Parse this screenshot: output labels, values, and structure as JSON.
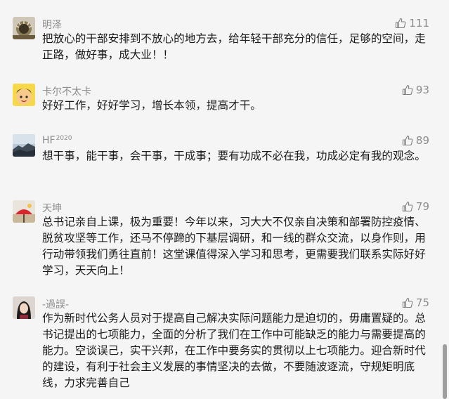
{
  "comments": [
    {
      "user": "明泽",
      "user_sup": "",
      "likes": "111",
      "text": "把放心的干部安排到不放心的地方去，给年轻干部充分的信任，足够的空间，走正路，做好事，成大业！！"
    },
    {
      "user": "卡尔不太卡",
      "user_sup": "",
      "likes": "93",
      "text": "好好工作，好好学习，增长本领，提高才干。"
    },
    {
      "user": "HF",
      "user_sup": "2020",
      "likes": "89",
      "text": "想干事，能干事，会干事，干成事；要有功成不必在我，功成必定有我的观念。"
    },
    {
      "user": "天坤",
      "user_sup": "",
      "likes": "79",
      "text": "总书记亲自上课，极为重要！今年以来，习大大不仅亲自决策和部署防控疫情、脱贫攻坚等工作，还马不停蹄的下基层调研，和一线的群众交流，以身作则，用行动带领我们勇往直前！这堂课值得深入学习和思考，更需要我们联系实际好好学习，天天向上！"
    },
    {
      "user": "-過誤-",
      "user_sup": "",
      "likes": "75",
      "text": "作为新时代公务人员对于提高自己解决实际问题能力是迫切的，毋庸置疑的。总书记提出的七项能力，全面的分析了我们在工作中可能缺乏的能力与需要提高的能力。空谈误己，实干兴邦，在工作中要务实的贯彻以上七项能力。迎合新时代的建设，有利于社会主义发展的事情坚决的去做，不要随波逐流，守规矩明底线，力求完善自己"
    }
  ]
}
